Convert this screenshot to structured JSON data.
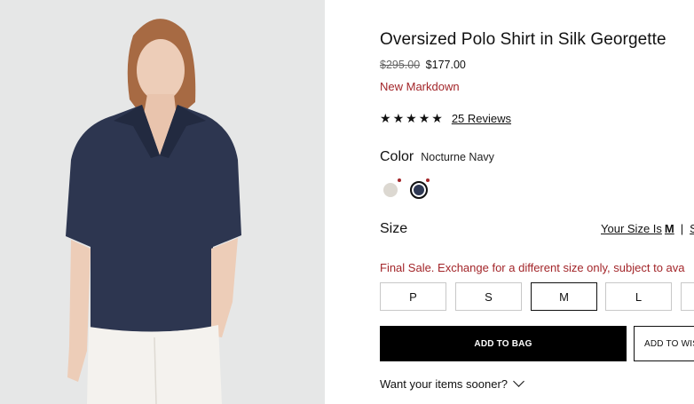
{
  "product": {
    "title": "Oversized Polo Shirt in Silk Georgette",
    "original_price": "$295.00",
    "sale_price": "$177.00",
    "markdown_label": "New Markdown",
    "rating_stars": 5,
    "reviews_link": "25 Reviews"
  },
  "color": {
    "label": "Color",
    "selected_name": "Nocturne Navy",
    "swatches": [
      {
        "name": "ivory",
        "hex": "#dcd8d1",
        "selected": false
      },
      {
        "name": "nocturne-navy",
        "hex": "#2f3954",
        "selected": true
      }
    ],
    "sale_dot_color": "#a3262a"
  },
  "size": {
    "label": "Size",
    "your_size_prefix": "Your Size Is",
    "your_size_value": "M",
    "separator": "|",
    "second_link": "S",
    "final_sale_note": "Final Sale. Exchange for a different size only, subject to ava",
    "options": [
      "P",
      "S",
      "M",
      "L",
      ""
    ],
    "selected": "M"
  },
  "actions": {
    "add_to_bag": "ADD TO BAG",
    "add_to_wishlist": "ADD TO WIS"
  },
  "delivery": {
    "sooner_link": "Want your items sooner?"
  },
  "colors": {
    "accent_red": "#a3262a",
    "primary_button": "#000000",
    "photo_background": "#e6e7e7"
  }
}
